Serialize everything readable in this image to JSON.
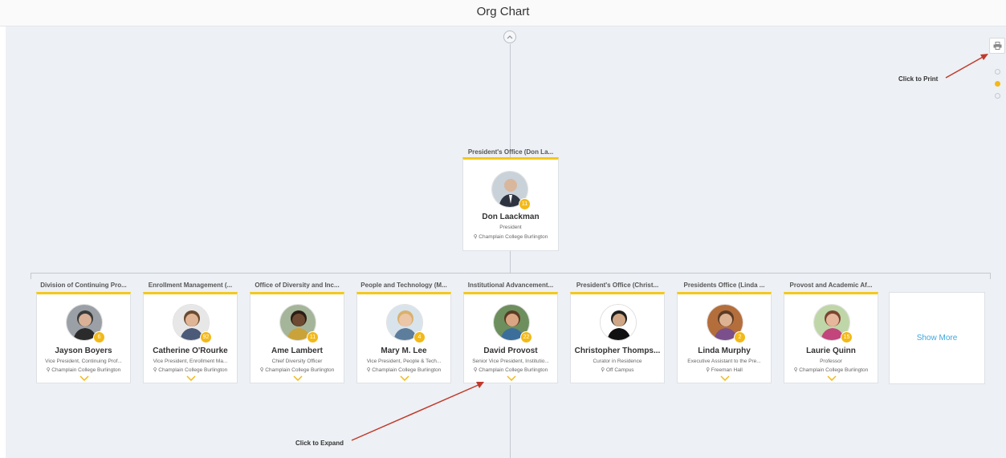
{
  "header": {
    "title": "Org Chart"
  },
  "colors": {
    "accent": "#f3b918",
    "link": "#3aa7e0",
    "arrow": "#c0392b"
  },
  "icons": {
    "collapse_up": "chevron-up-icon",
    "print": "printer-icon",
    "location": "map-pin-icon",
    "expand": "chevron-down-icon"
  },
  "pager": {
    "dots": 3,
    "active_index": 1
  },
  "president": {
    "department": "President's Office (Don La...",
    "name": "Don Laackman",
    "title": "President",
    "location": "Champlain College Burlington",
    "reports": "11"
  },
  "reports": [
    {
      "department": "Division of Continuing Pro...",
      "name": "Jayson Boyers",
      "title": "Vice President, Continuing Prof...",
      "location": "Champlain College Burlington",
      "count": "6",
      "expandable": true
    },
    {
      "department": "Enrollment Management (...",
      "name": "Catherine O'Rourke",
      "title": "Vice President, Enrollment Ma...",
      "location": "Champlain College Burlington",
      "count": "92",
      "expandable": true
    },
    {
      "department": "Office of Diversity and Inc...",
      "name": "Ame Lambert",
      "title": "Chief Diversity Officer",
      "location": "Champlain College Burlington",
      "count": "11",
      "expandable": true
    },
    {
      "department": "People and Technology (M...",
      "name": "Mary M. Lee",
      "title": "Vice President, People & Tech...",
      "location": "Champlain College Burlington",
      "count": "4",
      "expandable": true
    },
    {
      "department": "Institutional Advancement...",
      "name": "David Provost",
      "title": "Senior Vice President, Institutio...",
      "location": "Champlain College Burlington",
      "count": "22",
      "expandable": true
    },
    {
      "department": "President's Office (Christ...",
      "name": "Christopher Thomps...",
      "title": "Curator in Residence",
      "location": "Off Campus",
      "count": "",
      "expandable": false
    },
    {
      "department": "Presidents Office (Linda ...",
      "name": "Linda Murphy",
      "title": "Executive Assistant to the Pre...",
      "location": "Freeman Hall",
      "count": "2",
      "expandable": true
    },
    {
      "department": "Provost and Academic Af...",
      "name": "Laurie Quinn",
      "title": "Professor",
      "location": "Champlain College Burlington",
      "count": "15",
      "expandable": true
    }
  ],
  "show_more": {
    "label": "Show More"
  },
  "annotations": {
    "print": "Click to Print",
    "expand": "Click to Expand"
  }
}
